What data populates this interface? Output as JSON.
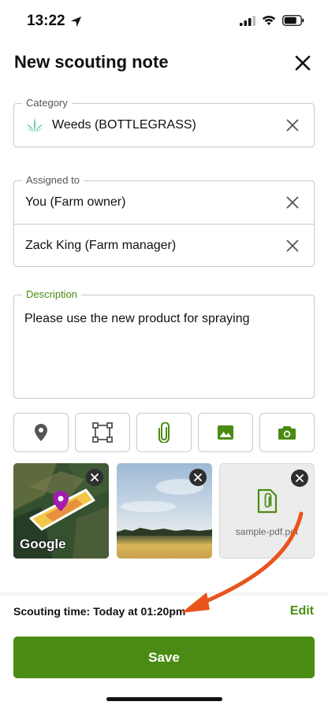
{
  "status": {
    "time": "13:22"
  },
  "header": {
    "title": "New scouting note"
  },
  "category": {
    "legend": "Category",
    "value": "Weeds (BOTTLEGRASS)",
    "icon": "grass-icon"
  },
  "assigned": {
    "legend": "Assigned to",
    "items": [
      {
        "label": "You (Farm owner)"
      },
      {
        "label": "Zack King (Farm manager)"
      }
    ]
  },
  "description": {
    "legend": "Description",
    "value": "Please use the new product for spraying"
  },
  "actions": [
    {
      "name": "location-pin-icon"
    },
    {
      "name": "draw-area-icon"
    },
    {
      "name": "paperclip-icon"
    },
    {
      "name": "image-icon"
    },
    {
      "name": "camera-icon"
    }
  ],
  "attachments": {
    "map_label": "Google",
    "file_name": "sample-pdf.pdf"
  },
  "footer": {
    "scouting_time": "Scouting time: Today at 01:20pm",
    "edit_label": "Edit",
    "save_label": "Save"
  },
  "colors": {
    "accent": "#4a8c13",
    "overlay_arrow": "#e8541c"
  }
}
